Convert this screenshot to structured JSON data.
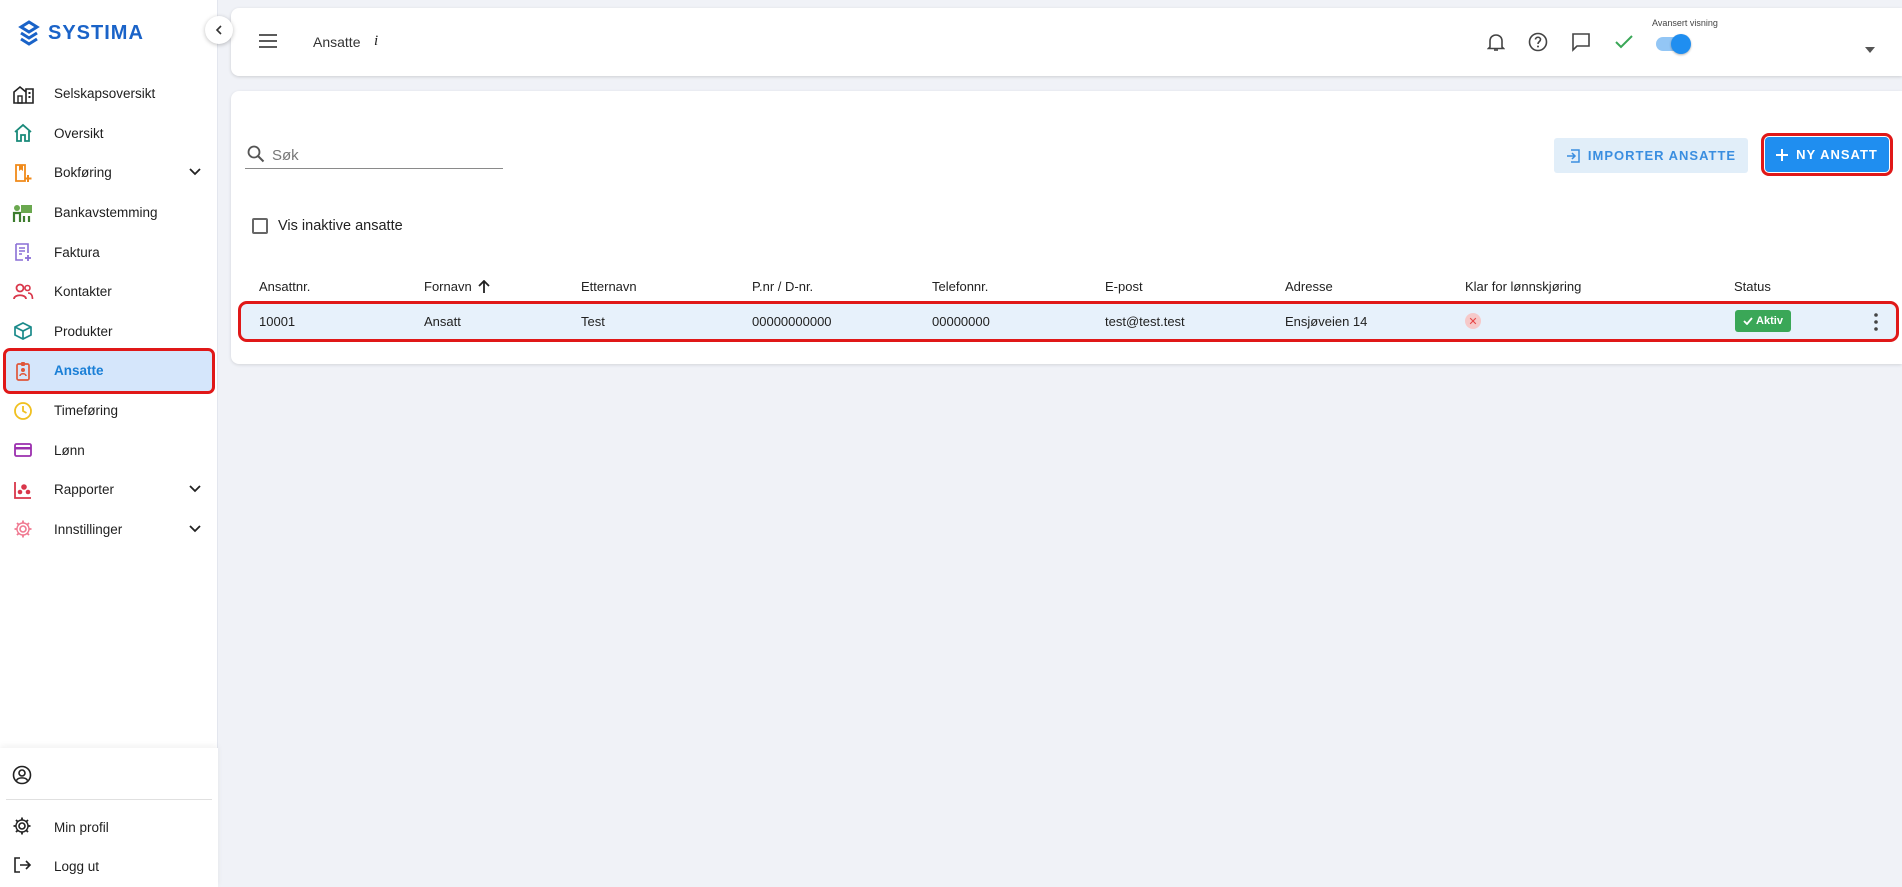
{
  "app": {
    "logo_text": "SYSTIMA"
  },
  "sidebar": {
    "items": [
      {
        "label": "Selskapsoversikt",
        "icon": "building-icon"
      },
      {
        "label": "Oversikt",
        "icon": "home-icon"
      },
      {
        "label": "Bokføring",
        "icon": "bookkeeping-icon",
        "expandable": true
      },
      {
        "label": "Bankavstemming",
        "icon": "bank-icon"
      },
      {
        "label": "Faktura",
        "icon": "invoice-icon"
      },
      {
        "label": "Kontakter",
        "icon": "contacts-icon"
      },
      {
        "label": "Produkter",
        "icon": "cube-icon"
      },
      {
        "label": "Ansatte",
        "icon": "badge-icon",
        "active": true
      },
      {
        "label": "Timeføring",
        "icon": "clock-icon"
      },
      {
        "label": "Lønn",
        "icon": "card-icon"
      },
      {
        "label": "Rapporter",
        "icon": "chart-icon",
        "expandable": true
      },
      {
        "label": "Innstillinger",
        "icon": "cog-icon",
        "expandable": true
      }
    ],
    "bottom": {
      "profile_label": "Min profil",
      "logout_label": "Logg ut"
    }
  },
  "header": {
    "title": "Ansatte",
    "info": "i",
    "advanced_view_label": "Avansert visning",
    "advanced_view_on": true
  },
  "toolbar": {
    "search_placeholder": "Søk",
    "import_label": "IMPORTER ANSATTE",
    "new_label": "NY ANSATT",
    "show_inactive_label": "Vis inaktive ansatte"
  },
  "table": {
    "columns": [
      "Ansattnr.",
      "Fornavn",
      "Etternavn",
      "P.nr / D-nr.",
      "Telefonnr.",
      "E-post",
      "Adresse",
      "Klar for lønnskjøring",
      "Status"
    ],
    "rows": [
      {
        "ansattnr": "10001",
        "fornavn": "Ansatt",
        "etternavn": "Test",
        "pnr": "00000000000",
        "telefon": "00000000",
        "epost": "test@test.test",
        "adresse": "Ensjøveien 14",
        "ready_symbol": "✕",
        "status": "Aktiv"
      }
    ]
  },
  "colors": {
    "brand": "#1a63c8",
    "primary": "#1f8ef0",
    "active_bg": "#d5e6fb",
    "status_green": "#3aa757",
    "highlight_red": "#e01818"
  }
}
